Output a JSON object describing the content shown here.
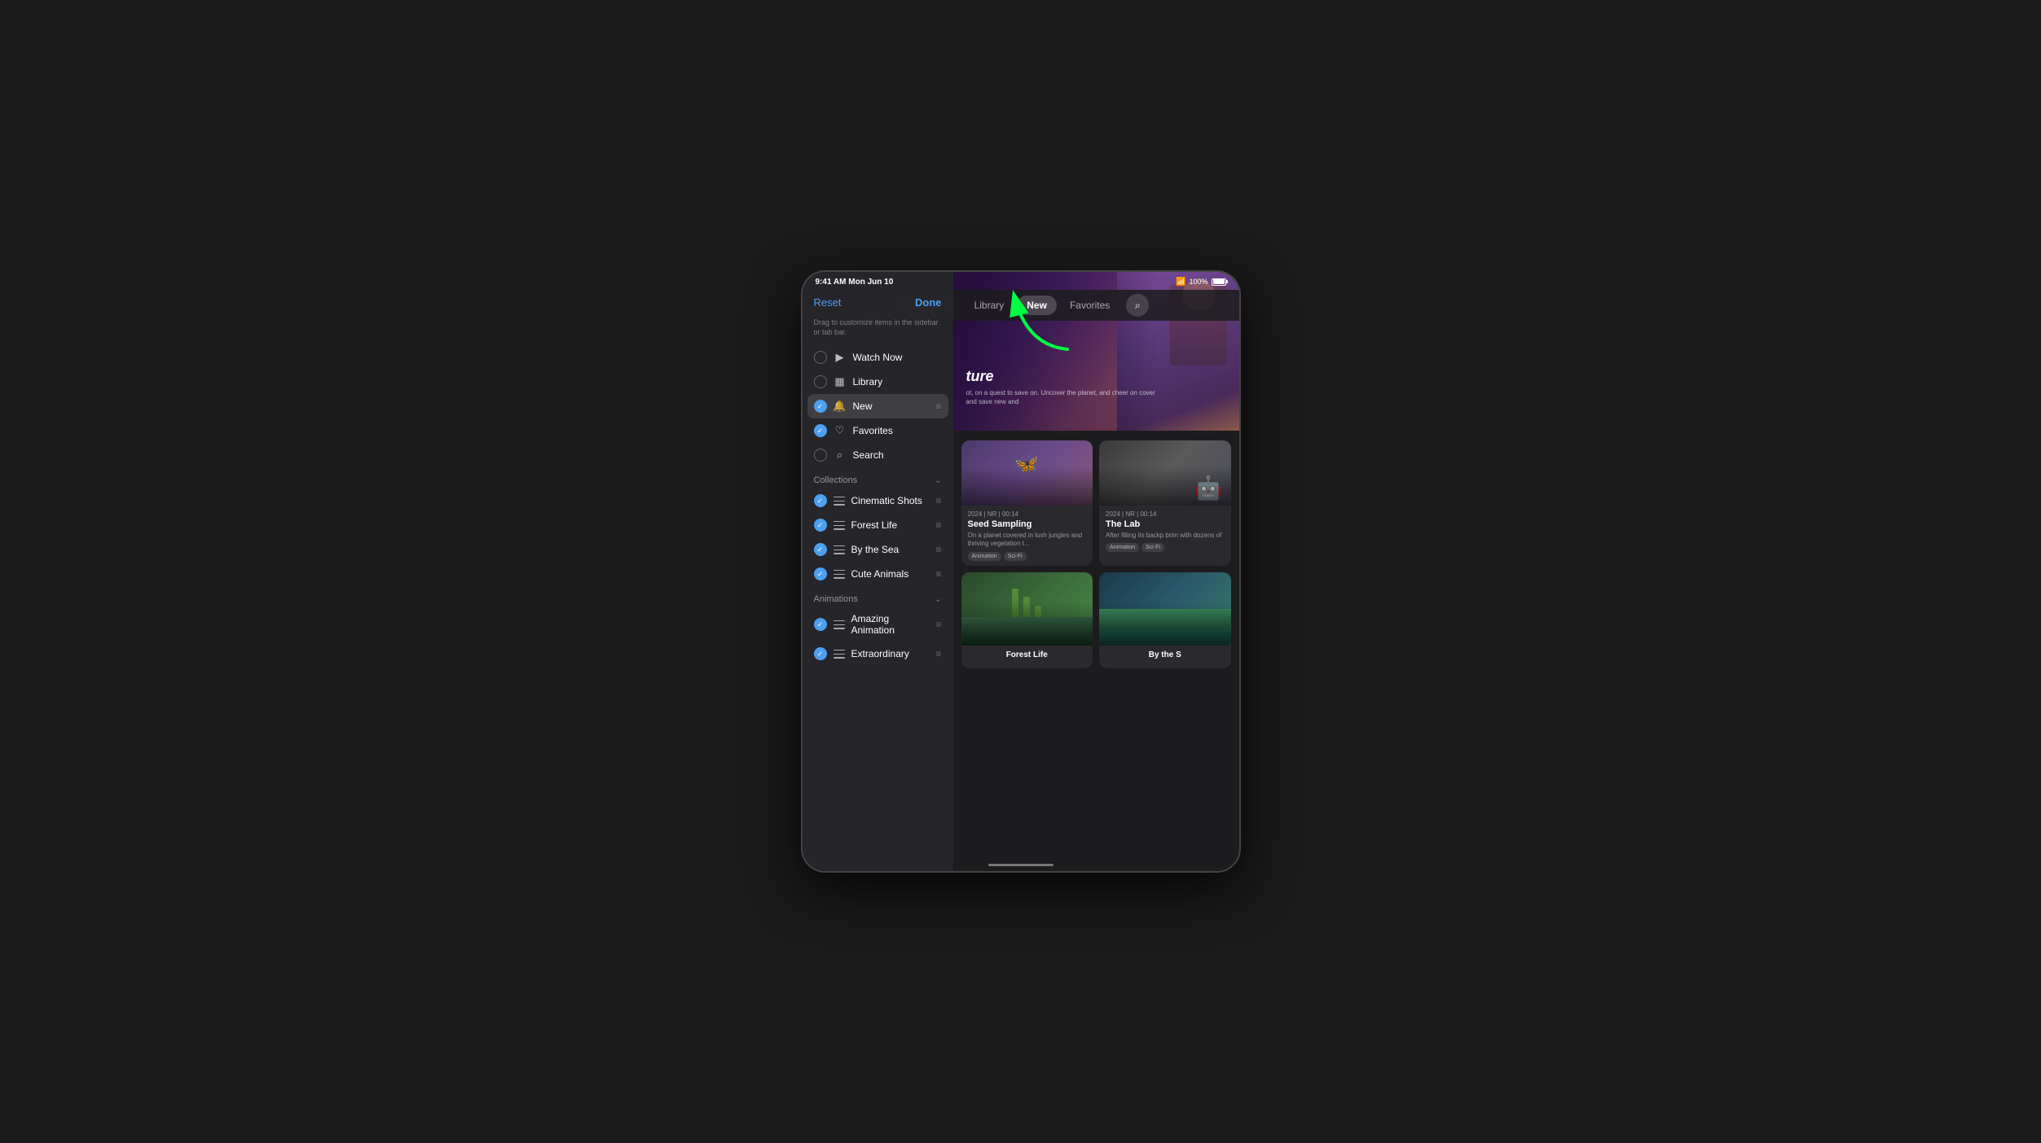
{
  "device": {
    "status_bar": {
      "time": "9:41 AM  Mon Jun 10",
      "battery": "100%",
      "wifi": true
    }
  },
  "nav": {
    "tabs": [
      {
        "id": "watch-now",
        "label": "Watch Now",
        "active": false
      },
      {
        "id": "library",
        "label": "Library",
        "active": false
      },
      {
        "id": "new",
        "label": "New",
        "active": true
      },
      {
        "id": "favorites",
        "label": "Favorites",
        "active": false
      }
    ],
    "new_badge": "New"
  },
  "sidebar": {
    "reset_label": "Reset",
    "done_label": "Done",
    "hint": "Drag to customize items in the sidebar or tab bar.",
    "main_items": [
      {
        "id": "watch-now",
        "label": "Watch Now",
        "icon": "▶",
        "checked": false
      },
      {
        "id": "library",
        "label": "Library",
        "icon": "▦",
        "checked": false
      },
      {
        "id": "new",
        "label": "New",
        "icon": "🔔",
        "checked": true,
        "highlighted": true
      },
      {
        "id": "favorites",
        "label": "Favorites",
        "icon": "♡",
        "checked": true
      },
      {
        "id": "search",
        "label": "Search",
        "icon": "⌕",
        "checked": false
      }
    ],
    "collections": {
      "title": "Collections",
      "items": [
        {
          "id": "cinematic-shots",
          "label": "Cinematic Shots",
          "checked": true
        },
        {
          "id": "forest-life",
          "label": "Forest Life",
          "checked": true
        },
        {
          "id": "by-the-sea",
          "label": "By the Sea",
          "checked": true
        },
        {
          "id": "cute-animals",
          "label": "Cute Animals",
          "checked": true
        }
      ]
    },
    "animations": {
      "title": "Animations",
      "items": [
        {
          "id": "amazing-animation",
          "label": "Amazing Animation",
          "checked": true
        },
        {
          "id": "extraordinary",
          "label": "Extraordinary",
          "checked": true
        }
      ]
    }
  },
  "hero": {
    "title": "ture",
    "description": "ot, on a quest to save on. Uncover the planet, and cheer on cover and save new and"
  },
  "content_cards": {
    "row1": [
      {
        "id": "seed-sampling",
        "year": "2024",
        "rating": "NR",
        "duration": "00:14",
        "title": "Seed Sampling",
        "desc": "On a planet covered in lush jungles and thriving vegetation t...",
        "tags": [
          "Animation",
          "Sci-Fi"
        ],
        "thumb_type": "seed"
      },
      {
        "id": "the-lab",
        "year": "2024",
        "rating": "NR",
        "duration": "00:14",
        "title": "The Lab",
        "desc": "After filling its backp brim with dozens of",
        "tags": [
          "Animation",
          "Sci-Fi"
        ],
        "thumb_type": "lab"
      }
    ],
    "row2": [
      {
        "id": "forest-life",
        "title": "Forest Life",
        "thumb_type": "forest"
      },
      {
        "id": "by-the-sea",
        "title": "By the S",
        "thumb_type": "sea"
      }
    ]
  }
}
